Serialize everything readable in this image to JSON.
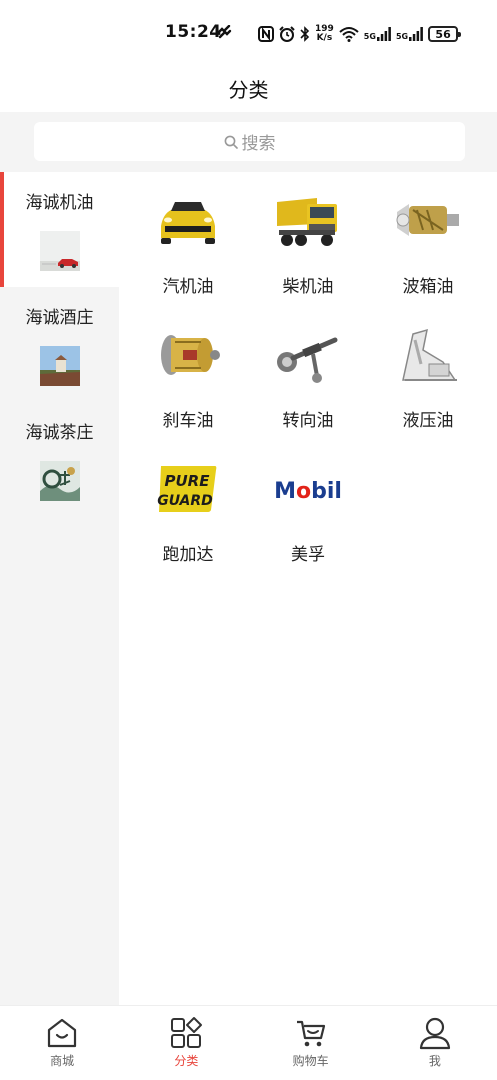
{
  "status_bar": {
    "time": "15:24",
    "speed_top": "199",
    "speed_bottom": "K/s",
    "net1": "5G",
    "net2": "5G",
    "battery": "56"
  },
  "header": {
    "title": "分类"
  },
  "search": {
    "placeholder": "搜索"
  },
  "sidebar": {
    "items": [
      {
        "label": "海诚机油",
        "active": true
      },
      {
        "label": "海诚酒庄",
        "active": false
      },
      {
        "label": "海诚茶庄",
        "active": false
      }
    ]
  },
  "grid": {
    "items": [
      {
        "label": "汽机油",
        "icon": "yellow-car-icon"
      },
      {
        "label": "柴机油",
        "icon": "dump-truck-icon"
      },
      {
        "label": "波箱油",
        "icon": "gearbox-icon"
      },
      {
        "label": "刹车油",
        "icon": "brake-icon"
      },
      {
        "label": "转向油",
        "icon": "steering-rack-icon"
      },
      {
        "label": "液压油",
        "icon": "excavator-arm-icon"
      },
      {
        "label": "跑加达",
        "icon": "pureguard-logo",
        "logo_text": "PURE GUARD"
      },
      {
        "label": "美孚",
        "icon": "mobil-logo",
        "logo_text": "Mobil"
      }
    ]
  },
  "tabbar": {
    "items": [
      {
        "label": "商城",
        "icon": "home-icon",
        "active": false
      },
      {
        "label": "分类",
        "icon": "category-icon",
        "active": true
      },
      {
        "label": "购物车",
        "icon": "cart-icon",
        "active": false
      },
      {
        "label": "我",
        "icon": "user-icon",
        "active": false
      }
    ]
  },
  "colors": {
    "accent": "#e8453c",
    "background": "#f4f4f4",
    "mobil_blue": "#1a3d8f",
    "mobil_red": "#e2231a"
  }
}
